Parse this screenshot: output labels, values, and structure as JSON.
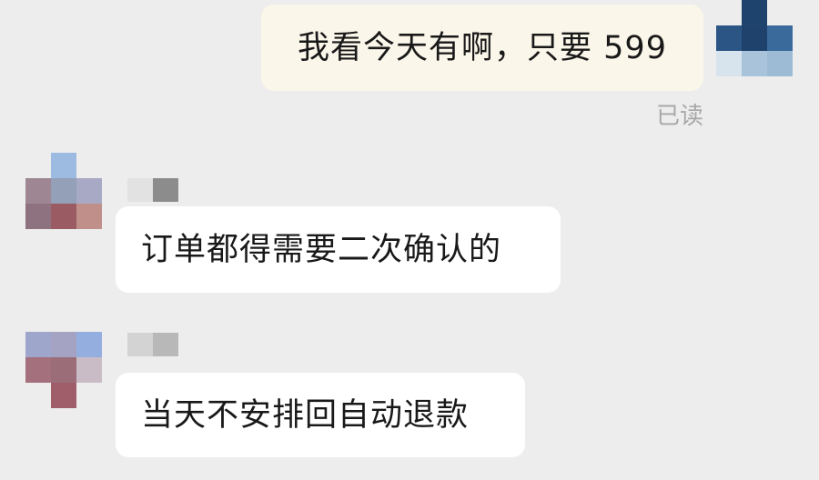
{
  "messages": [
    {
      "sender": "self",
      "text": "我看今天有啊，只要 599",
      "status": "已读"
    },
    {
      "sender": "other",
      "text": "订单都得需要二次确认的"
    },
    {
      "sender": "other",
      "text": "当天不安排回自动退款"
    }
  ],
  "colors": {
    "background": "#ededed",
    "self_bubble": "#fbf6ea",
    "other_bubble": "#ffffff",
    "text": "#191919",
    "read_receipt": "#a8a8a8"
  }
}
